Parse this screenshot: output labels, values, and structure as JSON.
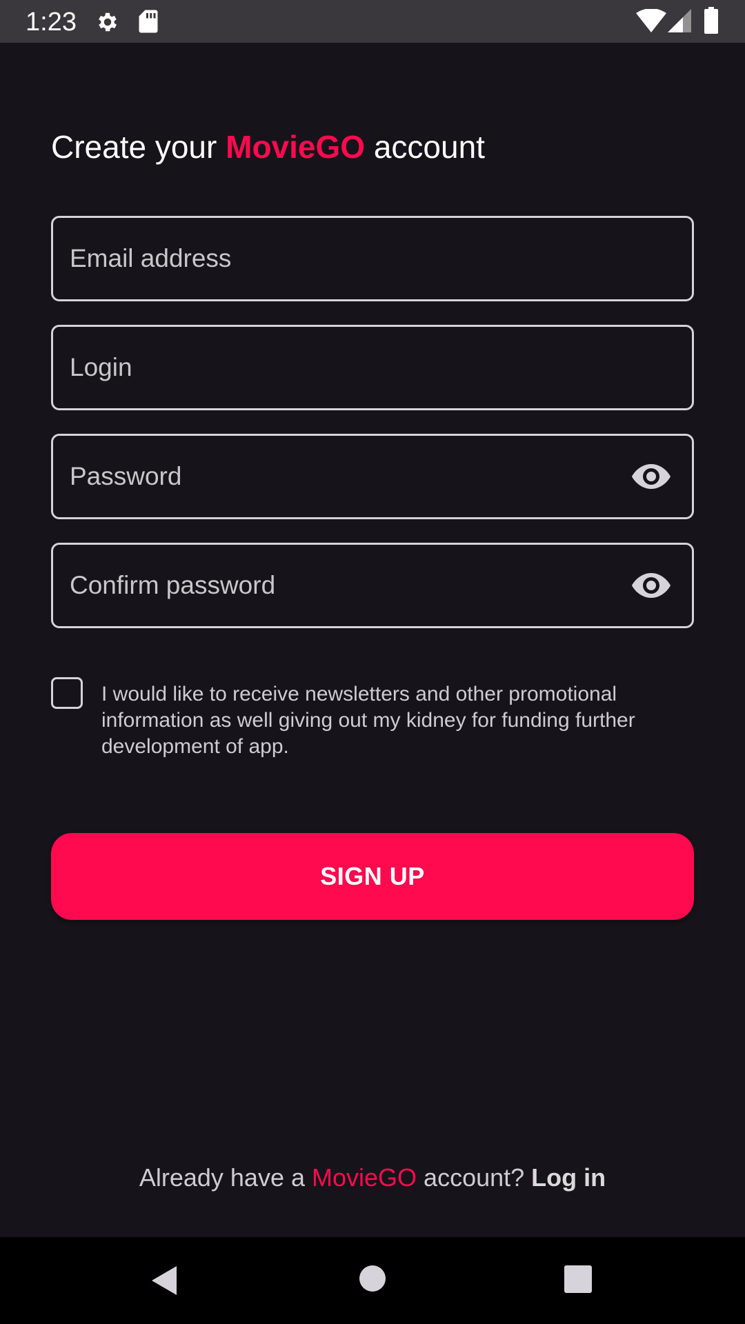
{
  "status_bar": {
    "time": "1:23",
    "icons": [
      "gear-icon",
      "sd-card-icon",
      "wifi-icon",
      "cell-signal-icon",
      "battery-icon"
    ]
  },
  "title": {
    "prefix": "Create your ",
    "brand": "MovieGO",
    "suffix": " account"
  },
  "form": {
    "email_placeholder": "Email address",
    "login_placeholder": "Login",
    "password_placeholder": "Password",
    "confirm_password_placeholder": "Confirm password",
    "newsletter_checked": false,
    "newsletter_label": "I would like to receive newsletters and other promotional information as well giving out my kidney for funding further development of app.",
    "signup_label": "SIGN UP"
  },
  "footer": {
    "prefix": "Already have a ",
    "brand": "MovieGO",
    "middle": " account? ",
    "login_label": "Log in"
  },
  "nav_bar": {
    "icons": [
      "back-icon",
      "home-icon",
      "recents-icon"
    ]
  },
  "colors": {
    "accent": "#ff0a4e",
    "background": "#16141a",
    "status_bar": "#3a373d",
    "nav_bar": "#000000"
  }
}
